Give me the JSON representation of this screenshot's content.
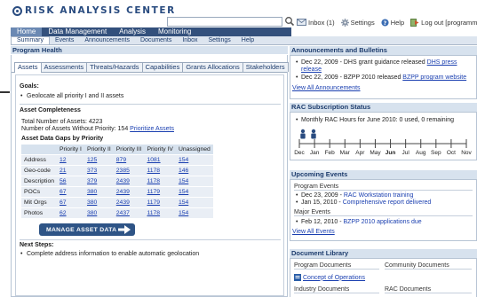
{
  "app": {
    "logo_text": "RISK ANALYSIS CENTER"
  },
  "search": {
    "placeholder": "",
    "value": ""
  },
  "utility": {
    "inbox": "Inbox (1)",
    "settings": "Settings",
    "help": "Help",
    "logout": "Log out [programmanager]"
  },
  "nav": {
    "top": [
      "Home",
      "Data Management",
      "Analysis",
      "Monitoring"
    ],
    "sub": [
      "Summary",
      "Events",
      "Announcements",
      "Documents",
      "Inbox",
      "Settings",
      "Help"
    ]
  },
  "program_health": {
    "title": "Program Health",
    "tabs": [
      "Assets",
      "Assessments",
      "Threats/Hazards",
      "Capabilities",
      "Grants Allocations",
      "Stakeholders"
    ],
    "goals_heading": "Goals:",
    "goals": [
      "Geolocate all priority I and II assets"
    ],
    "completeness_heading": "Asset Completeness",
    "total_assets": "Total Number of Assets: 4223",
    "without_priority_label": "Number of Assets Without Priority: 154",
    "prioritize_link": "Prioritize Assets",
    "gaps_heading": "Asset Data Gaps by Priority",
    "table": {
      "headers": [
        "",
        "Priority I",
        "Priority II",
        "Priority III",
        "Priority IV",
        "Unassigned"
      ],
      "rows": [
        {
          "label": "Address",
          "values": [
            "12",
            "125",
            "879",
            "1081",
            "154"
          ]
        },
        {
          "label": "Geo-code",
          "values": [
            "21",
            "373",
            "2385",
            "1178",
            "146"
          ]
        },
        {
          "label": "Description",
          "values": [
            "56",
            "379",
            "2439",
            "1178",
            "154"
          ]
        },
        {
          "label": "POCs",
          "values": [
            "67",
            "380",
            "2439",
            "1179",
            "154"
          ]
        },
        {
          "label": "Mit Orgs",
          "values": [
            "67",
            "380",
            "2439",
            "1179",
            "154"
          ]
        },
        {
          "label": "Photos",
          "values": [
            "62",
            "380",
            "2437",
            "1178",
            "154"
          ]
        }
      ]
    },
    "manage_button": "MANAGE ASSET DATA",
    "next_steps_heading": "Next Steps:",
    "next_steps": [
      "Complete address information to enable automatic geolocation"
    ]
  },
  "announcements": {
    "title": "Announcements and Bulletins",
    "items": [
      {
        "text": "Dec 22, 2009 - DHS grant guidance released ",
        "link": "DHS press",
        "link2": "release"
      },
      {
        "text": "Dec 22, 2009 - BZPP 2010 released ",
        "link": "BZPP program website"
      }
    ],
    "view_all": "View All Announcements"
  },
  "subscription": {
    "title": "RAC Subscription Status",
    "item": "Monthly RAC Hours for June 2010: 0 used, 0 remaining",
    "months": [
      "Dec",
      "Jan",
      "Feb",
      "Mar",
      "Apr",
      "May",
      "Jun",
      "Jul",
      "Aug",
      "Sep",
      "Oct",
      "Nov"
    ],
    "current_month": "Jun"
  },
  "upcoming": {
    "title": "Upcoming Events",
    "program_heading": "Program Events",
    "program_events": [
      {
        "date": "Dec 23, 2009 - ",
        "link": "RAC Workstation training"
      },
      {
        "date": "Jan 15, 2010 - ",
        "link": "Comprehensive report delivered"
      }
    ],
    "major_heading": "Major Events",
    "major_events": [
      {
        "date": "Feb 12, 2010 - ",
        "link": "BZPP 2010 applications due"
      }
    ],
    "view_all": "View All Events"
  },
  "library": {
    "title": "Document Library",
    "program_docs": "Program Documents",
    "community_docs": "Community Documents",
    "concept_link": "Concept of Operations",
    "industry_docs": "Industry Documents",
    "rac_docs": "RAC Documents"
  }
}
